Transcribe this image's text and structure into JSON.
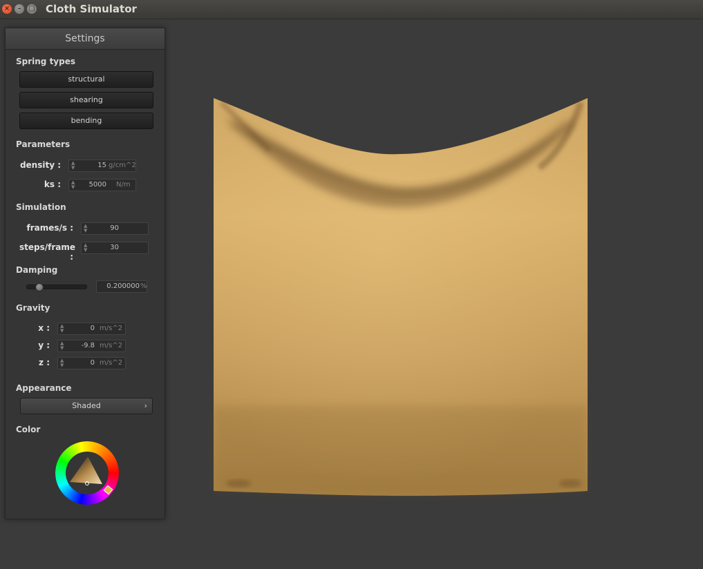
{
  "window": {
    "title": "Cloth Simulator",
    "close_glyph": "×",
    "min_glyph": "–",
    "max_glyph": "□"
  },
  "settings": {
    "header": "Settings",
    "spring_types": {
      "label": "Spring types",
      "buttons": [
        "structural",
        "shearing",
        "bending"
      ]
    },
    "parameters": {
      "label": "Parameters",
      "density": {
        "label": "density :",
        "value": "15",
        "unit": "g/cm^2"
      },
      "ks": {
        "label": "ks :",
        "value": "5000",
        "unit": "N/m"
      }
    },
    "simulation": {
      "label": "Simulation",
      "fps": {
        "label": "frames/s :",
        "value": "90"
      },
      "steps": {
        "label": "steps/frame :",
        "value": "30"
      }
    },
    "damping": {
      "label": "Damping",
      "value": "0.200000",
      "unit": "%",
      "slider_fraction": 0.2
    },
    "gravity": {
      "label": "Gravity",
      "x": {
        "label": "x :",
        "value": "0",
        "unit": "m/s^2"
      },
      "y": {
        "label": "y :",
        "value": "-9.8",
        "unit": "m/s^2"
      },
      "z": {
        "label": "z :",
        "value": "0",
        "unit": "m/s^2"
      }
    },
    "appearance": {
      "label": "Appearance",
      "selected": "Shaded",
      "chevron": "›"
    },
    "color": {
      "label": "Color",
      "selected_hex": "#d9b06a"
    }
  },
  "colors": {
    "background": "#3b3b3b",
    "cloth": "#d9b06a",
    "panel": "#353535"
  },
  "icons": {
    "spin": "spinner-arrows-icon"
  }
}
